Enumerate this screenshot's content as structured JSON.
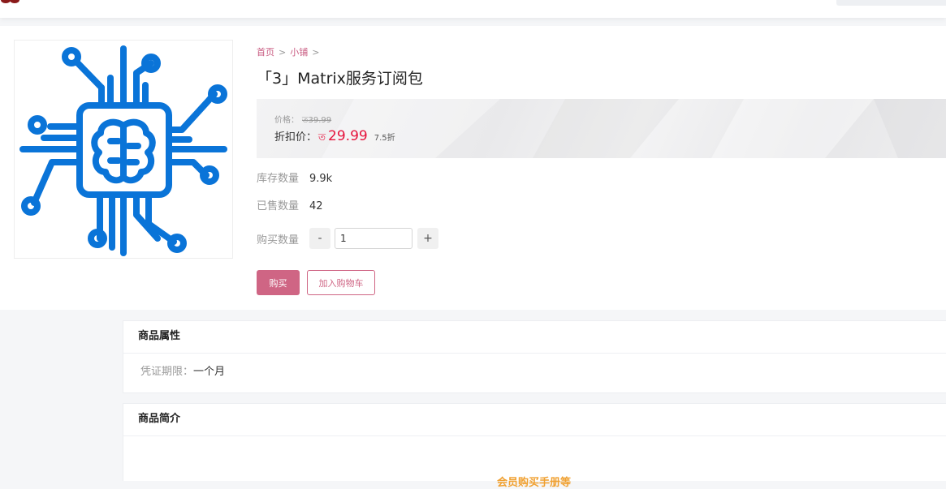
{
  "breadcrumb": {
    "home": "首页",
    "shop": "小铺",
    "sep": ">"
  },
  "product": {
    "title": "「3」Matrix服务订阅包",
    "price_label": "价格：",
    "original_price": "ত39.99",
    "discount_label": "折扣价：",
    "currency": "ত",
    "discount_price": "29.99",
    "discount_rate": "7.5折",
    "stock_label": "库存数量",
    "stock_value": "9.9k",
    "sold_label": "已售数量",
    "sold_value": "42",
    "qty_label": "购买数量",
    "qty_minus": "-",
    "qty_plus": "+",
    "qty_value": "1",
    "buy_label": "购买",
    "cart_label": "加入购物车"
  },
  "attributes": {
    "title": "商品属性",
    "items": [
      {
        "key": "凭证期限：",
        "value": "一个月"
      }
    ]
  },
  "description": {
    "title": "商品简介",
    "teaser": "会员购买手册等"
  },
  "colors": {
    "accent": "#cf6584",
    "price": "#e6133c",
    "icon_blue": "#0a74d8"
  },
  "icons": {
    "product_image": "ai-chip-brain-icon",
    "logo": "brand-logo-icon"
  }
}
